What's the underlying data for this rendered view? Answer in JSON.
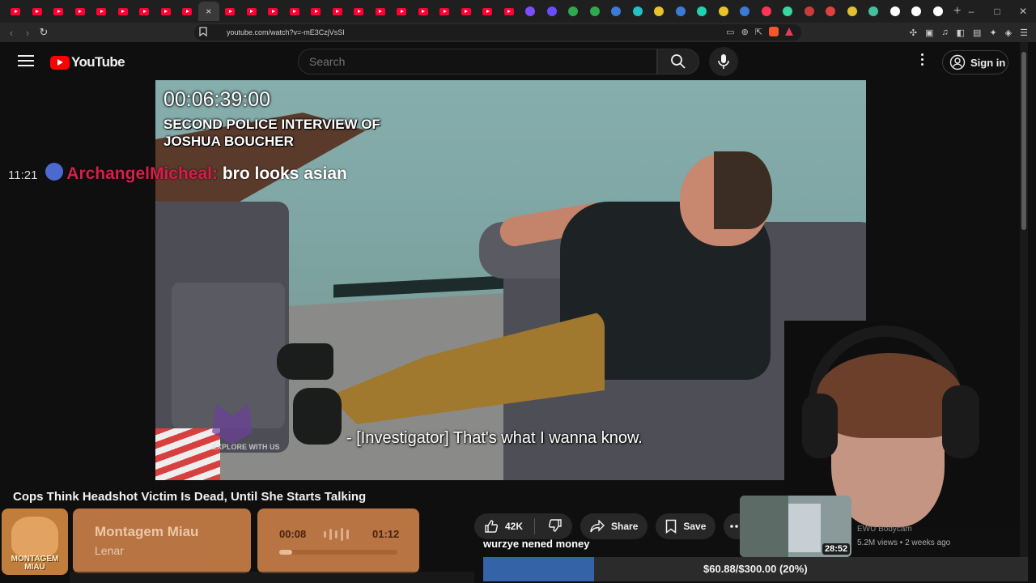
{
  "browser": {
    "url": "youtube.com/watch?v=-mE3CzjVsSI",
    "new_tab_symbol": "+",
    "tab_close_symbol": "×",
    "window_controls": [
      "–",
      "□",
      "✕"
    ]
  },
  "youtube": {
    "logo_text": "YouTube",
    "search_placeholder": "Search",
    "sign_in_label": "Sign in"
  },
  "video": {
    "timecode": "00:06:39:00",
    "overlay_title": "SECOND POLICE INTERVIEW OF JOSHUA BOUCHER",
    "subtitle": "- [Investigator] That's what I wanna know.",
    "watermark_text": "EXPLORE WITH US",
    "title": "Cops Think Headshot Victim Is Dead, Until She Starts Talking"
  },
  "chat": {
    "time": "11:21",
    "username": "ArchangelMicheal:",
    "message": "bro looks asian",
    "username_color": "#d91d4b"
  },
  "actions": {
    "like_count": "42K",
    "share_label": "Share",
    "save_label": "Save"
  },
  "recommendation": {
    "duration": "28:52",
    "channel": "EWU Bodycam",
    "meta": "5.2M views • 2 weeks ago"
  },
  "music": {
    "cover_text": "MONTAGEM MIAU",
    "song": "Montagem Miau",
    "artist": "Lenar",
    "current_time": "00:08",
    "total_time": "01:12",
    "progress": 0.11
  },
  "donation": {
    "label": "wurzye nened money",
    "progress_text": "$60.88/$300.00 (20%)",
    "progress": 0.2029,
    "bar_color": "#3563a8"
  }
}
